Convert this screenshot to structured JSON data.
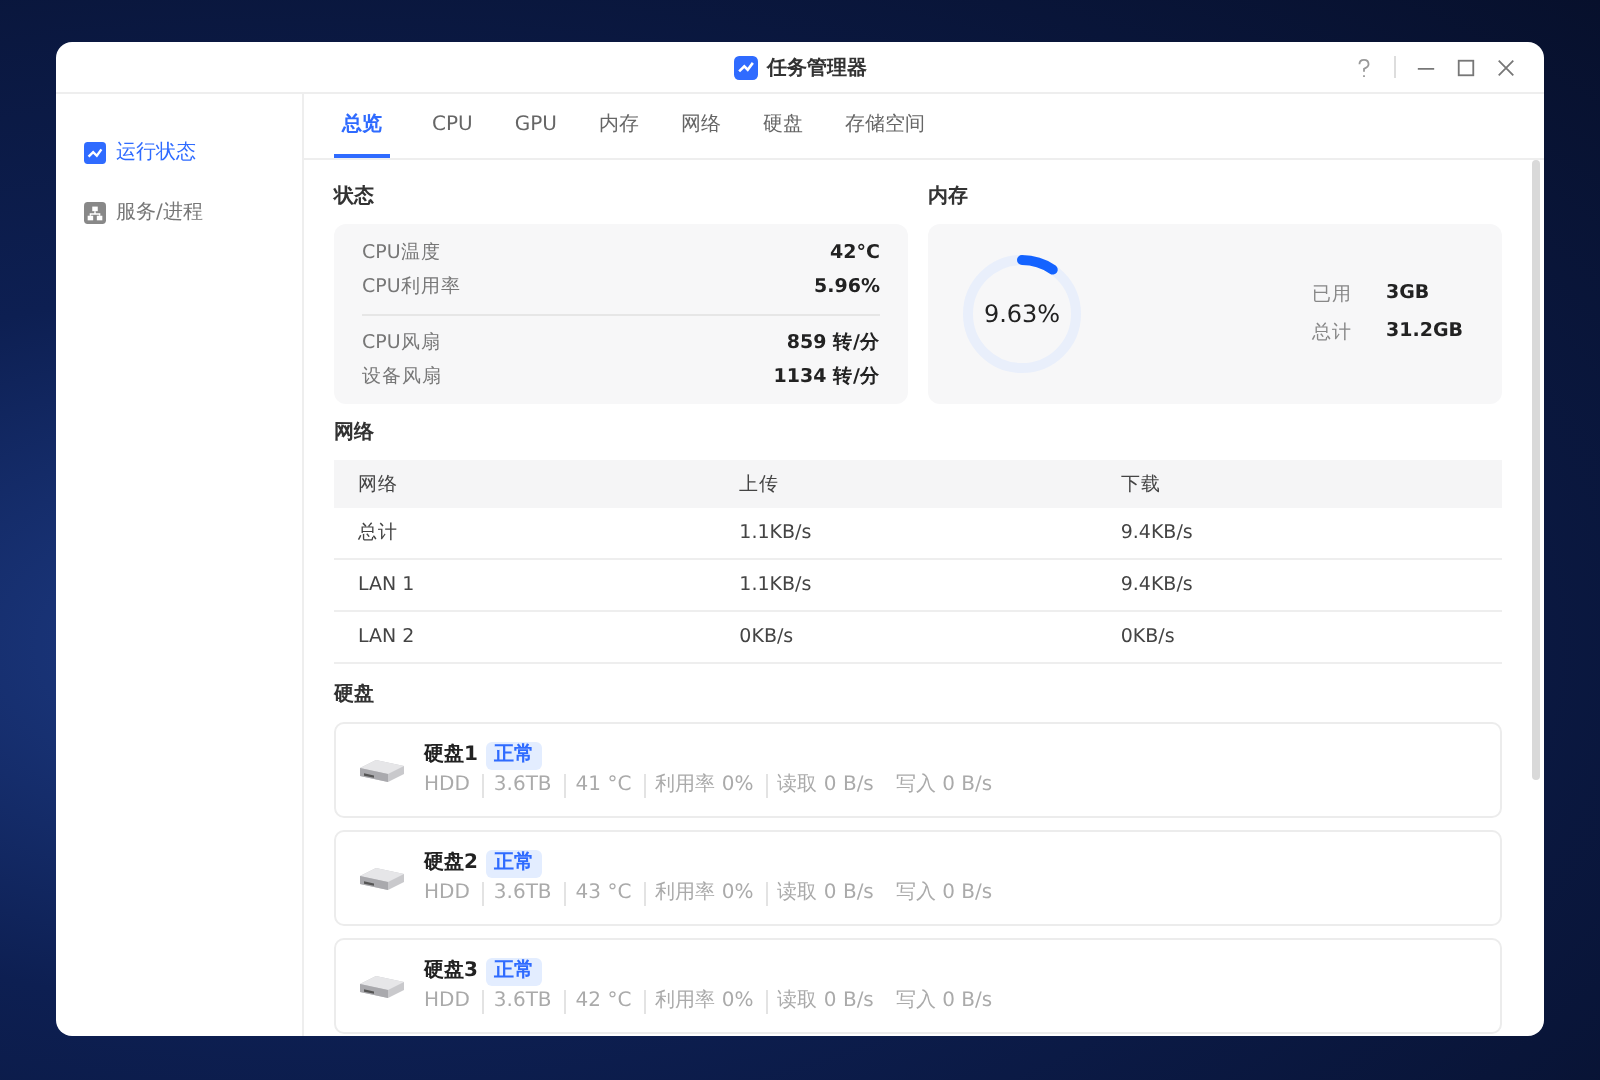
{
  "window": {
    "title": "任务管理器"
  },
  "sidebar": {
    "items": [
      {
        "label": "运行状态",
        "selected": true
      },
      {
        "label": "服务/进程",
        "selected": false
      }
    ]
  },
  "tabs": [
    {
      "label": "总览",
      "selected": true
    },
    {
      "label": "CPU",
      "selected": false
    },
    {
      "label": "GPU",
      "selected": false
    },
    {
      "label": "内存",
      "selected": false
    },
    {
      "label": "网络",
      "selected": false
    },
    {
      "label": "硬盘",
      "selected": false
    },
    {
      "label": "存储空间",
      "selected": false
    }
  ],
  "status": {
    "title": "状态",
    "groups": [
      [
        {
          "label": "CPU温度",
          "value": "42°C"
        },
        {
          "label": "CPU利用率",
          "value": "5.96%"
        }
      ],
      [
        {
          "label": "CPU风扇",
          "value": "859 转/分"
        },
        {
          "label": "设备风扇",
          "value": "1134 转/分"
        }
      ]
    ]
  },
  "memory": {
    "title": "内存",
    "level": 0.0963,
    "reading": "9.63%",
    "rows": [
      {
        "label": "已用",
        "value": "3GB"
      },
      {
        "label": "总计",
        "value": "31.2GB"
      }
    ]
  },
  "network": {
    "title": "网络",
    "columns": [
      "网络",
      "上传",
      "下载"
    ],
    "rows": [
      [
        "总计",
        "1.1KB/s",
        "9.4KB/s"
      ],
      [
        "LAN 1",
        "1.1KB/s",
        "9.4KB/s"
      ],
      [
        "LAN 2",
        "0KB/s",
        "0KB/s"
      ]
    ]
  },
  "disks": {
    "title": "硬盘",
    "items": [
      {
        "name": "硬盘1",
        "badge": "正常",
        "specs": [
          "HDD",
          "3.6TB",
          "41 °C",
          "利用率 0%",
          "读取 0 B/s",
          "写入 0 B/s"
        ]
      },
      {
        "name": "硬盘2",
        "badge": "正常",
        "specs": [
          "HDD",
          "3.6TB",
          "43 °C",
          "利用率 0%",
          "读取 0 B/s",
          "写入 0 B/s"
        ]
      },
      {
        "name": "硬盘3",
        "badge": "正常",
        "specs": [
          "HDD",
          "3.6TB",
          "42 °C",
          "利用率 0%",
          "读取 0 B/s",
          "写入 0 B/s"
        ]
      }
    ]
  }
}
